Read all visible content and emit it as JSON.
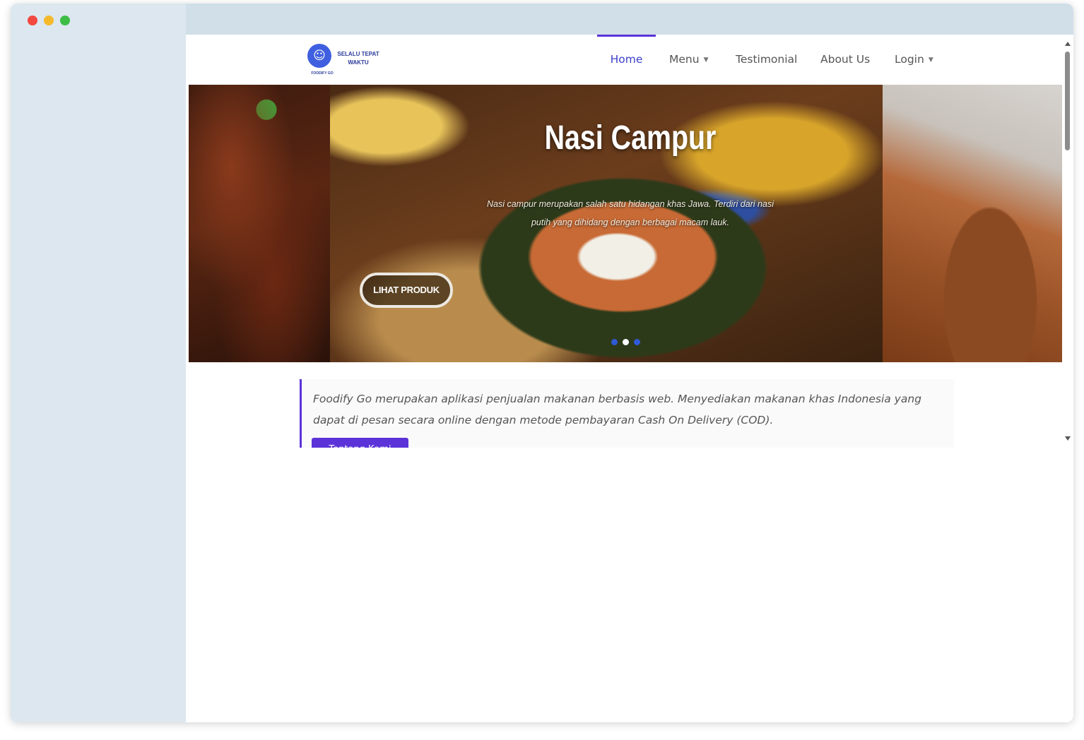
{
  "logo": {
    "tagline": "SELALU TEPAT WAKTU",
    "brand": "FOODIFY GO",
    "icon": "delivery-mascot-icon"
  },
  "nav": {
    "home": "Home",
    "menu": "Menu",
    "testimonial": "Testimonial",
    "about": "About Us",
    "login": "Login"
  },
  "hero": {
    "title": "Nasi Campur",
    "description": "Nasi campur merupakan salah satu hidangan khas Jawa. Terdiri dari nasi putih yang dihidang dengan berbagai macam lauk.",
    "button": "LIHAT PRODUK",
    "slides": 3,
    "active_slide": 2
  },
  "about": {
    "text": "Foodify Go merupakan aplikasi penjualan makanan berbasis web. Menyediakan makanan khas Indonesia yang dapat di pesan secara online dengan metode pembayaran Cash On Delivery (COD).",
    "button": "Tentang Kami"
  },
  "colors": {
    "accent": "#5b33d8",
    "nav_active": "#3a3fc9",
    "window_side": "#dce7ef"
  }
}
